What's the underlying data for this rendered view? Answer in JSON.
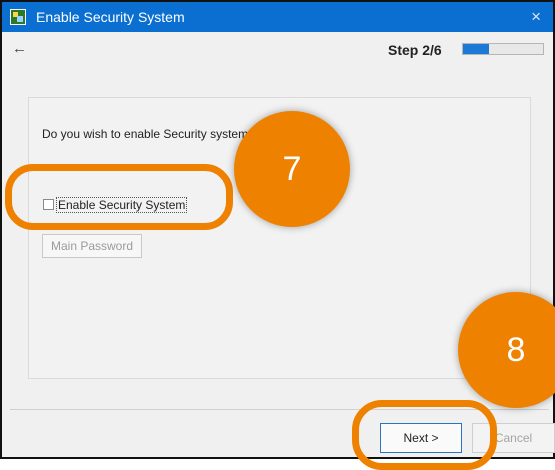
{
  "window": {
    "title": "Enable Security System",
    "close_icon": "×",
    "app_icon": "security-app-icon"
  },
  "nav": {
    "back_icon": "←",
    "step": "Step 2/6",
    "progress": 0.33
  },
  "content": {
    "question": "Do you wish to enable Security system?",
    "checkbox_label": "Enable Security System",
    "checkbox_checked": false,
    "main_password_button": "Main Password"
  },
  "footer": {
    "next_button": "Next >",
    "cancel_button": "Cancel"
  },
  "annotations": {
    "marker_7": "7",
    "marker_8": "8",
    "color": "#ee8100"
  }
}
